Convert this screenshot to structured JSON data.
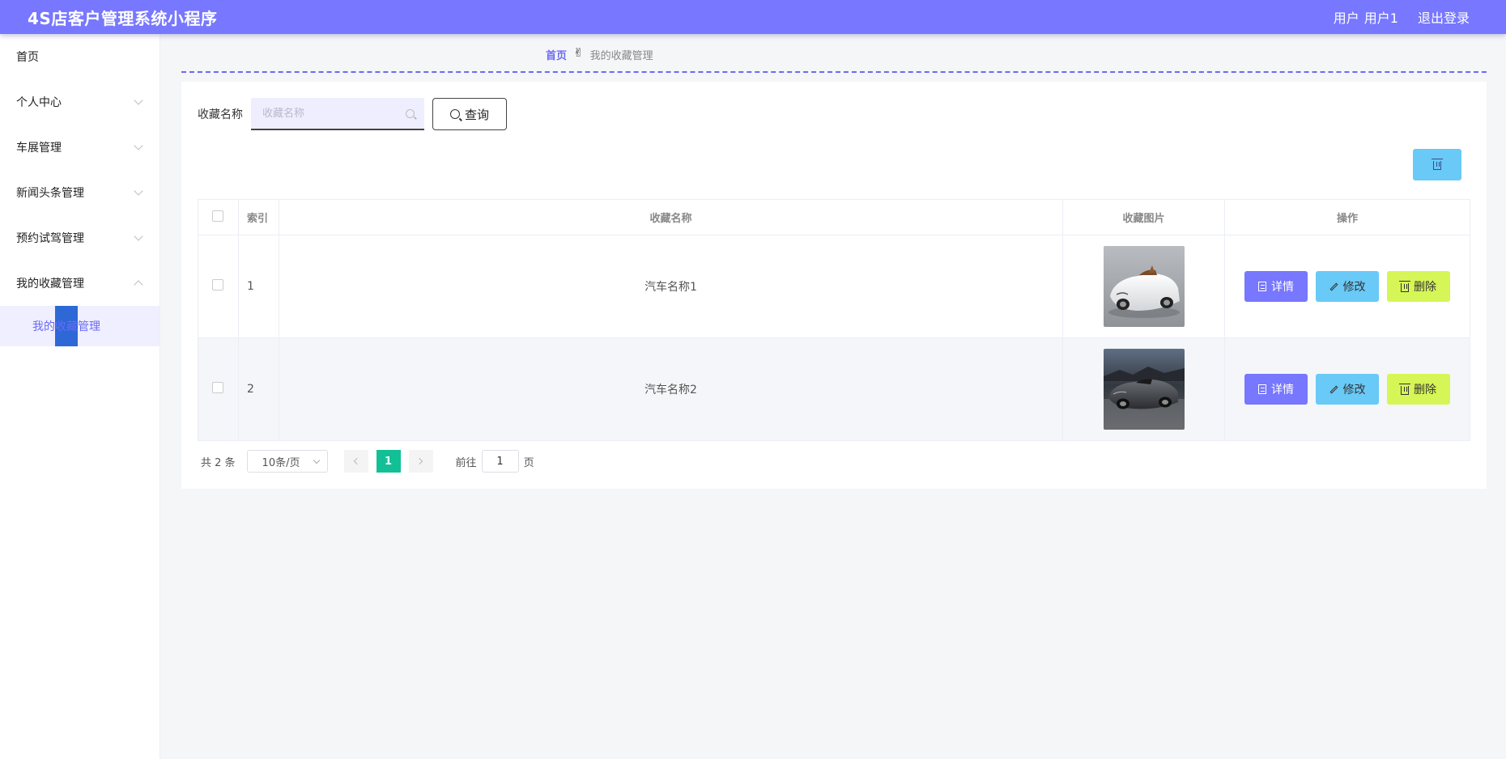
{
  "header": {
    "title": "4S店客户管理系统小程序",
    "user_prefix": "用户",
    "user_name": "用户1",
    "logout": "退出登录"
  },
  "sidebar": {
    "items": [
      {
        "label": "首页"
      },
      {
        "label": "个人中心"
      },
      {
        "label": "车展管理"
      },
      {
        "label": "新闻头条管理"
      },
      {
        "label": "预约试驾管理"
      },
      {
        "label": "我的收藏管理"
      }
    ],
    "subitem": "我的收藏管理"
  },
  "breadcrumb": {
    "home": "首页",
    "hand": "✌",
    "current": "我的收藏管理"
  },
  "search": {
    "label": "收藏名称",
    "placeholder": "收藏名称",
    "value": "",
    "button": "查询"
  },
  "table": {
    "headers": {
      "index": "索引",
      "name": "收藏名称",
      "image": "收藏图片",
      "ops": "操作"
    },
    "rows": [
      {
        "index": "1",
        "name": "汽车名称1",
        "image": "white-convertible-car-photo"
      },
      {
        "index": "2",
        "name": "汽车名称2",
        "image": "dark-convertible-car-photo"
      }
    ],
    "actions": {
      "detail": "详情",
      "edit": "修改",
      "delete": "删除"
    }
  },
  "pagination": {
    "total": "共 2 条",
    "page_size": "10条/页",
    "current_page": "1",
    "goto_prefix": "前往",
    "goto_value": "1",
    "goto_suffix": "页"
  },
  "colors": {
    "primary": "#7777ff",
    "edit": "#69c9f7",
    "delete": "#d6f556",
    "page_active": "#13c096"
  }
}
